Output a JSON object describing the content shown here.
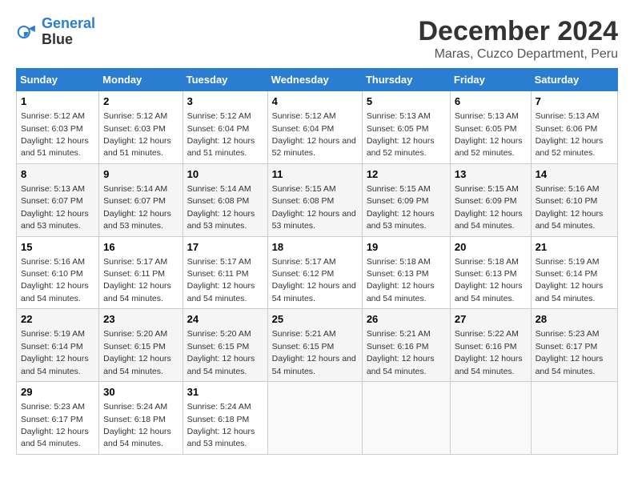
{
  "logo": {
    "line1": "General",
    "line2": "Blue"
  },
  "title": "December 2024",
  "subtitle": "Maras, Cuzco Department, Peru",
  "days_header": [
    "Sunday",
    "Monday",
    "Tuesday",
    "Wednesday",
    "Thursday",
    "Friday",
    "Saturday"
  ],
  "weeks": [
    [
      {
        "day": "1",
        "rise": "5:12 AM",
        "set": "6:03 PM",
        "daylight": "12 hours and 51 minutes."
      },
      {
        "day": "2",
        "rise": "5:12 AM",
        "set": "6:03 PM",
        "daylight": "12 hours and 51 minutes."
      },
      {
        "day": "3",
        "rise": "5:12 AM",
        "set": "6:04 PM",
        "daylight": "12 hours and 51 minutes."
      },
      {
        "day": "4",
        "rise": "5:12 AM",
        "set": "6:04 PM",
        "daylight": "12 hours and 52 minutes."
      },
      {
        "day": "5",
        "rise": "5:13 AM",
        "set": "6:05 PM",
        "daylight": "12 hours and 52 minutes."
      },
      {
        "day": "6",
        "rise": "5:13 AM",
        "set": "6:05 PM",
        "daylight": "12 hours and 52 minutes."
      },
      {
        "day": "7",
        "rise": "5:13 AM",
        "set": "6:06 PM",
        "daylight": "12 hours and 52 minutes."
      }
    ],
    [
      {
        "day": "8",
        "rise": "5:13 AM",
        "set": "6:07 PM",
        "daylight": "12 hours and 53 minutes."
      },
      {
        "day": "9",
        "rise": "5:14 AM",
        "set": "6:07 PM",
        "daylight": "12 hours and 53 minutes."
      },
      {
        "day": "10",
        "rise": "5:14 AM",
        "set": "6:08 PM",
        "daylight": "12 hours and 53 minutes."
      },
      {
        "day": "11",
        "rise": "5:15 AM",
        "set": "6:08 PM",
        "daylight": "12 hours and 53 minutes."
      },
      {
        "day": "12",
        "rise": "5:15 AM",
        "set": "6:09 PM",
        "daylight": "12 hours and 53 minutes."
      },
      {
        "day": "13",
        "rise": "5:15 AM",
        "set": "6:09 PM",
        "daylight": "12 hours and 54 minutes."
      },
      {
        "day": "14",
        "rise": "5:16 AM",
        "set": "6:10 PM",
        "daylight": "12 hours and 54 minutes."
      }
    ],
    [
      {
        "day": "15",
        "rise": "5:16 AM",
        "set": "6:10 PM",
        "daylight": "12 hours and 54 minutes."
      },
      {
        "day": "16",
        "rise": "5:17 AM",
        "set": "6:11 PM",
        "daylight": "12 hours and 54 minutes."
      },
      {
        "day": "17",
        "rise": "5:17 AM",
        "set": "6:11 PM",
        "daylight": "12 hours and 54 minutes."
      },
      {
        "day": "18",
        "rise": "5:17 AM",
        "set": "6:12 PM",
        "daylight": "12 hours and 54 minutes."
      },
      {
        "day": "19",
        "rise": "5:18 AM",
        "set": "6:13 PM",
        "daylight": "12 hours and 54 minutes."
      },
      {
        "day": "20",
        "rise": "5:18 AM",
        "set": "6:13 PM",
        "daylight": "12 hours and 54 minutes."
      },
      {
        "day": "21",
        "rise": "5:19 AM",
        "set": "6:14 PM",
        "daylight": "12 hours and 54 minutes."
      }
    ],
    [
      {
        "day": "22",
        "rise": "5:19 AM",
        "set": "6:14 PM",
        "daylight": "12 hours and 54 minutes."
      },
      {
        "day": "23",
        "rise": "5:20 AM",
        "set": "6:15 PM",
        "daylight": "12 hours and 54 minutes."
      },
      {
        "day": "24",
        "rise": "5:20 AM",
        "set": "6:15 PM",
        "daylight": "12 hours and 54 minutes."
      },
      {
        "day": "25",
        "rise": "5:21 AM",
        "set": "6:15 PM",
        "daylight": "12 hours and 54 minutes."
      },
      {
        "day": "26",
        "rise": "5:21 AM",
        "set": "6:16 PM",
        "daylight": "12 hours and 54 minutes."
      },
      {
        "day": "27",
        "rise": "5:22 AM",
        "set": "6:16 PM",
        "daylight": "12 hours and 54 minutes."
      },
      {
        "day": "28",
        "rise": "5:23 AM",
        "set": "6:17 PM",
        "daylight": "12 hours and 54 minutes."
      }
    ],
    [
      {
        "day": "29",
        "rise": "5:23 AM",
        "set": "6:17 PM",
        "daylight": "12 hours and 54 minutes."
      },
      {
        "day": "30",
        "rise": "5:24 AM",
        "set": "6:18 PM",
        "daylight": "12 hours and 54 minutes."
      },
      {
        "day": "31",
        "rise": "5:24 AM",
        "set": "6:18 PM",
        "daylight": "12 hours and 53 minutes."
      },
      null,
      null,
      null,
      null
    ]
  ]
}
